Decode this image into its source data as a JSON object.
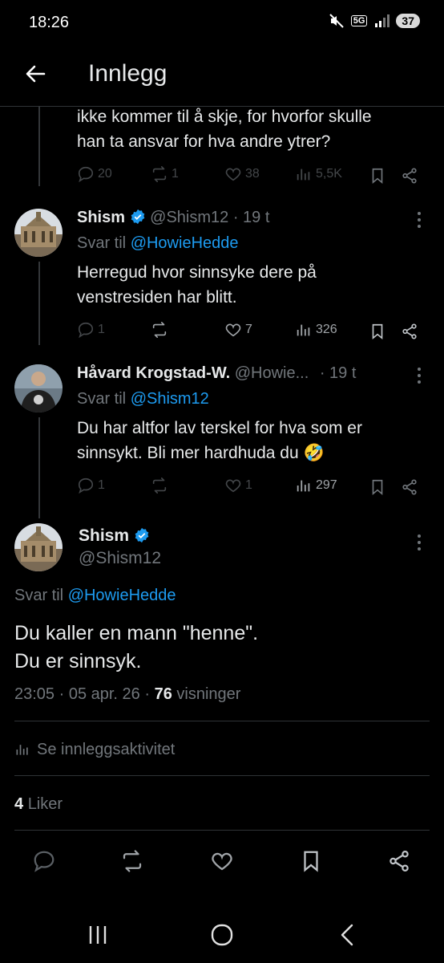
{
  "status": {
    "time": "18:26",
    "battery": "37",
    "network": "5G"
  },
  "header": {
    "title": "Innlegg"
  },
  "tweet_top": {
    "text_line1": "ikke kommer til å skje, for hvorfor skulle",
    "text_line2": "han ta ansvar for hva andre ytrer?",
    "replies": "20",
    "reposts": "1",
    "likes": "38",
    "views": "5,5K"
  },
  "tweet_shism": {
    "name": "Shism",
    "handle": "@Shism12",
    "time": "· 19 t",
    "reply_prefix": "Svar til",
    "reply_to": "@HowieHedde",
    "text_line1": "Herregud hvor sinnsyke dere på",
    "text_line2": "venstresiden har blitt.",
    "replies": "1",
    "reposts": "",
    "likes": "7",
    "views": "326"
  },
  "tweet_havard": {
    "name": "Håvard Krogstad-W.",
    "handle": "@Howie...",
    "time": "· 19 t",
    "reply_prefix": "Svar til",
    "reply_to": "@Shism12",
    "text_line1": "Du har altfor lav terskel for hva som er",
    "text_line2": "sinnsykt. Bli mer hardhuda du 🤣",
    "replies": "1",
    "reposts": "",
    "likes": "1",
    "views": "297"
  },
  "main_tweet": {
    "name": "Shism",
    "handle": "@Shism12",
    "reply_prefix": "Svar til",
    "reply_to": "@HowieHedde",
    "text_line1": "Du kaller en mann \"henne\".",
    "text_line2": "Du er sinnsyk.",
    "timestamp": "23:05 · 05 apr. 26 ·",
    "views_count": "76",
    "views_label": "visninger",
    "activity_label": "Se innleggsaktivitet",
    "likes_count": "4",
    "likes_label": "Liker"
  },
  "colors": {
    "background": "#000000",
    "text": "#e7e9ea",
    "muted": "#71767b",
    "link": "#1d9bf0",
    "divider": "#2f3336"
  }
}
